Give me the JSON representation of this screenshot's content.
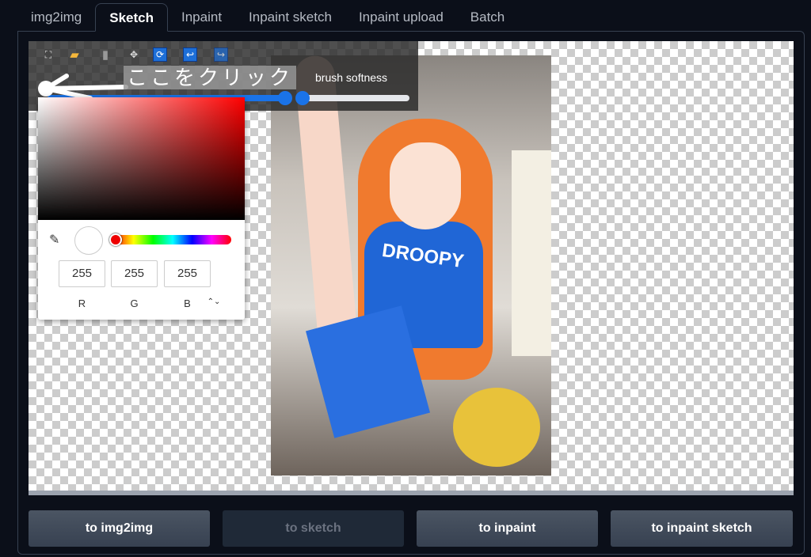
{
  "tabs": [
    {
      "label": "img2img"
    },
    {
      "label": "Sketch",
      "active": true
    },
    {
      "label": "Inpaint"
    },
    {
      "label": "Inpaint sketch"
    },
    {
      "label": "Inpaint upload"
    },
    {
      "label": "Batch"
    }
  ],
  "toolbar": {
    "icons": [
      "fullscreen-icon",
      "folder-icon",
      "trash-icon",
      "move-icon",
      "reset-icon",
      "undo-icon",
      "redo-icon"
    ],
    "brush_softness_label": "brush softness",
    "annotation": "ここをクリック"
  },
  "image": {
    "shirt_text": "DROOPY"
  },
  "color_picker": {
    "r": "255",
    "g": "255",
    "b": "255",
    "r_label": "R",
    "g_label": "G",
    "b_label": "B",
    "hue_color": "#ff0000",
    "current_color": "#ffffff"
  },
  "buttons": {
    "to_img2img": "to img2img",
    "to_sketch": "to sketch",
    "to_inpaint": "to inpaint",
    "to_inpaint_sketch": "to inpaint sketch"
  },
  "colors": {
    "accent": "#1a73e8",
    "background": "#0b0f19"
  }
}
